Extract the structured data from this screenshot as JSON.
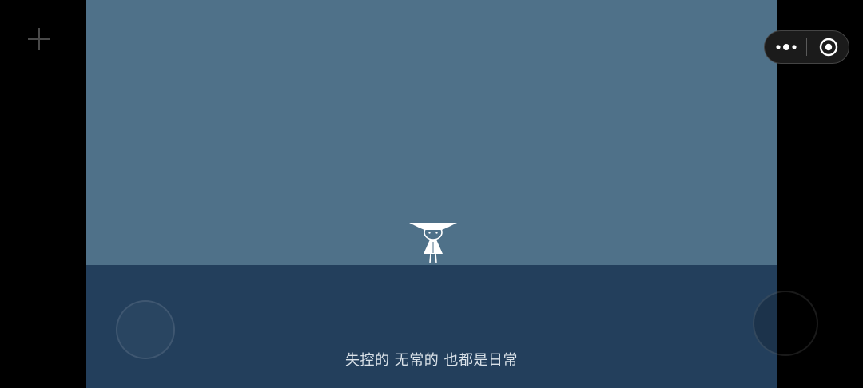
{
  "game": {
    "subtitle": "失控的 无常的 也都是日常"
  },
  "colors": {
    "sky": "#4f7189",
    "ground": "#233f5c",
    "character": "#ffffff",
    "subtitle": "#d9e1e8",
    "side_bars": "#000000"
  },
  "controls": {
    "left_joystick_icon": "joystick-ring",
    "right_joystick_icon": "joystick-ring"
  },
  "mini_program": {
    "add_icon": "plus-icon",
    "more_icon": "more-dots-icon",
    "close_icon": "target-circle-icon"
  }
}
